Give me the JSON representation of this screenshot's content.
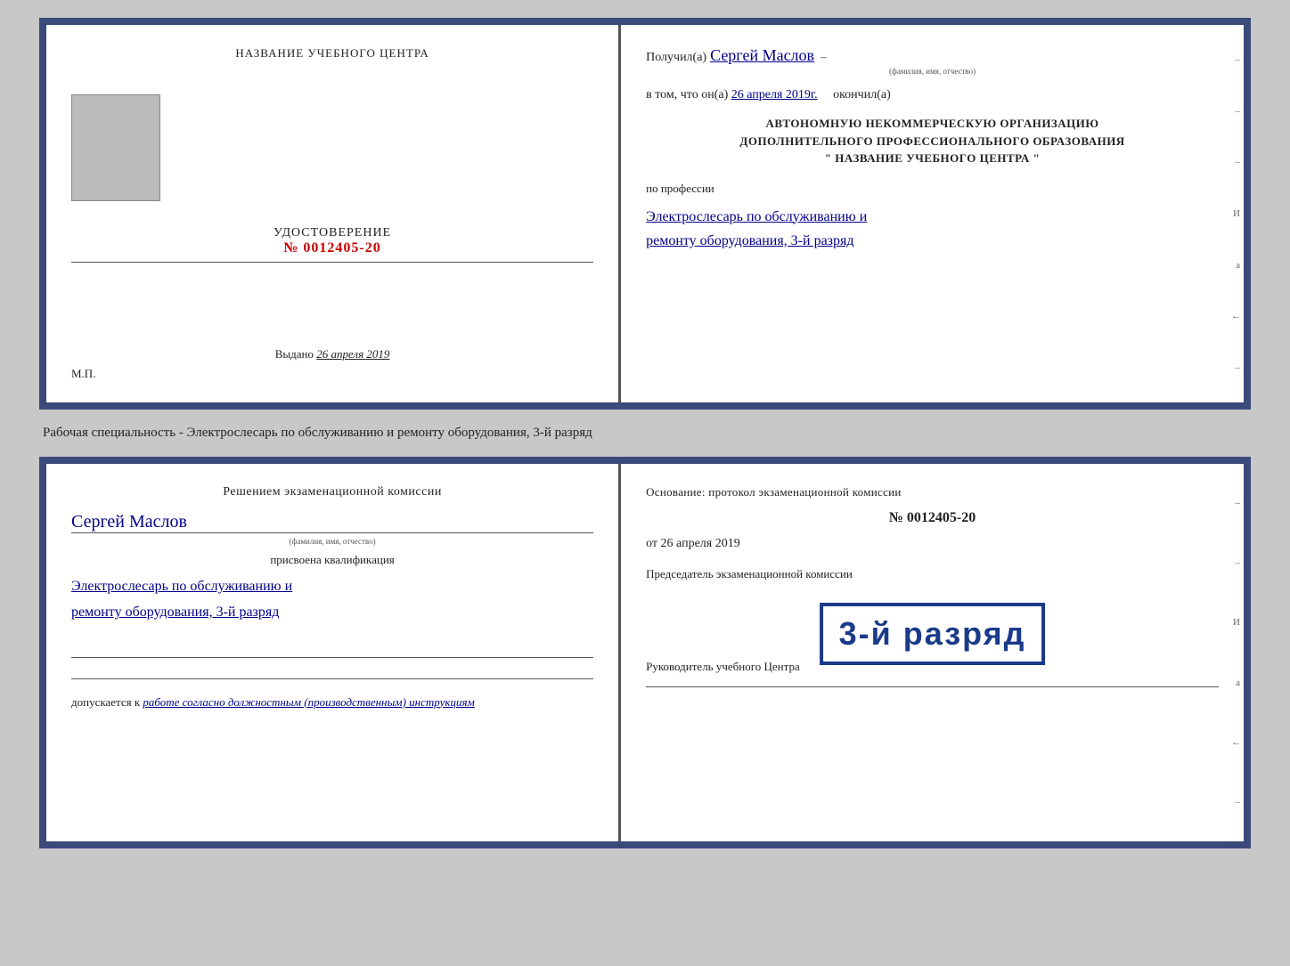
{
  "cert1": {
    "left": {
      "center_title": "НАЗВАНИЕ УЧЕБНОГО ЦЕНТРА",
      "cert_label": "УДОСТОВЕРЕНИЕ",
      "cert_number": "№ 0012405-20",
      "issued_prefix": "Выдано",
      "issued_date": "26 апреля 2019",
      "mp_label": "М.П."
    },
    "right": {
      "receiver_prefix": "Получил(а)",
      "receiver_name": "Сергей Маслов",
      "receiver_sublabel": "(фамилия, имя, отчество)",
      "date_prefix": "в том, что он(а)",
      "date_value": "26 апреля 2019г.",
      "date_suffix": "окончил(а)",
      "org_line1": "АВТОНОМНУЮ НЕКОММЕРЧЕСКУЮ ОРГАНИЗАЦИЮ",
      "org_line2": "ДОПОЛНИТЕЛЬНОГО ПРОФЕССИОНАЛЬНОГО ОБРАЗОВАНИЯ",
      "org_line3": "\"  НАЗВАНИЕ УЧЕБНОГО ЦЕНТРА  \"",
      "profession_label": "по профессии",
      "profession_line1": "Электрослесарь по обслуживанию и",
      "profession_line2": "ремонту оборудования, 3-й разряд",
      "deco_right": [
        "–",
        "–",
        "–",
        "–",
        "–",
        "И",
        "¡а",
        "←",
        "–",
        "–",
        "–",
        "–"
      ]
    }
  },
  "middle_text": "Рабочая специальность - Электрослесарь по обслуживанию и ремонту оборудования, 3-й разряд",
  "cert2": {
    "left": {
      "commission_title": "Решением экзаменационной комиссии",
      "name_handwritten": "Сергей Маслов",
      "name_sublabel": "(фамилия, имя, отчество)",
      "qualification_label": "присвоена квалификация",
      "qualification_line1": "Электрослесарь по обслуживанию и",
      "qualification_line2": "ремонту оборудования, 3-й разряд",
      "allowed_prefix": "допускается к",
      "allowed_text": "работе согласно должностным (производственным) инструкциям"
    },
    "right": {
      "basis_text": "Основание: протокол экзаменационной комиссии",
      "protocol_number": "№  0012405-20",
      "protocol_date_prefix": "от",
      "protocol_date": "26 апреля 2019",
      "chairman_label": "Председатель экзаменационной комиссии",
      "director_label": "Руководитель учебного Центра",
      "stamp_text": "3-й разряд",
      "deco_right": [
        "–",
        "–",
        "–",
        "–",
        "И",
        "¡а",
        "←",
        "–",
        "–",
        "–",
        "–"
      ]
    }
  }
}
